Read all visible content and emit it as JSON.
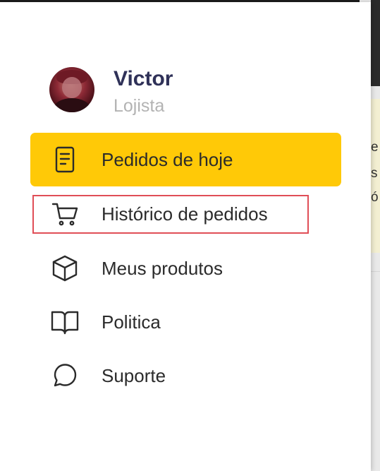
{
  "user": {
    "name": "Victor",
    "role": "Lojista"
  },
  "menu": {
    "items": [
      {
        "label": "Pedidos de hoje",
        "icon": "receipt-icon",
        "active": true
      },
      {
        "label": "Histórico de pedidos",
        "icon": "cart-icon",
        "active": false,
        "highlighted": true
      },
      {
        "label": "Meus produtos",
        "icon": "box-icon",
        "active": false
      },
      {
        "label": "Politica",
        "icon": "book-icon",
        "active": false
      },
      {
        "label": "Suporte",
        "icon": "chat-bubble-icon",
        "active": false
      }
    ]
  },
  "background_app": {
    "text_fragments": [
      "e",
      "s",
      "ó"
    ]
  },
  "colors": {
    "accent": "#ffc907",
    "name_text": "#2f3158",
    "role_text": "#b3b3b3",
    "highlight_border": "#e04e57"
  }
}
